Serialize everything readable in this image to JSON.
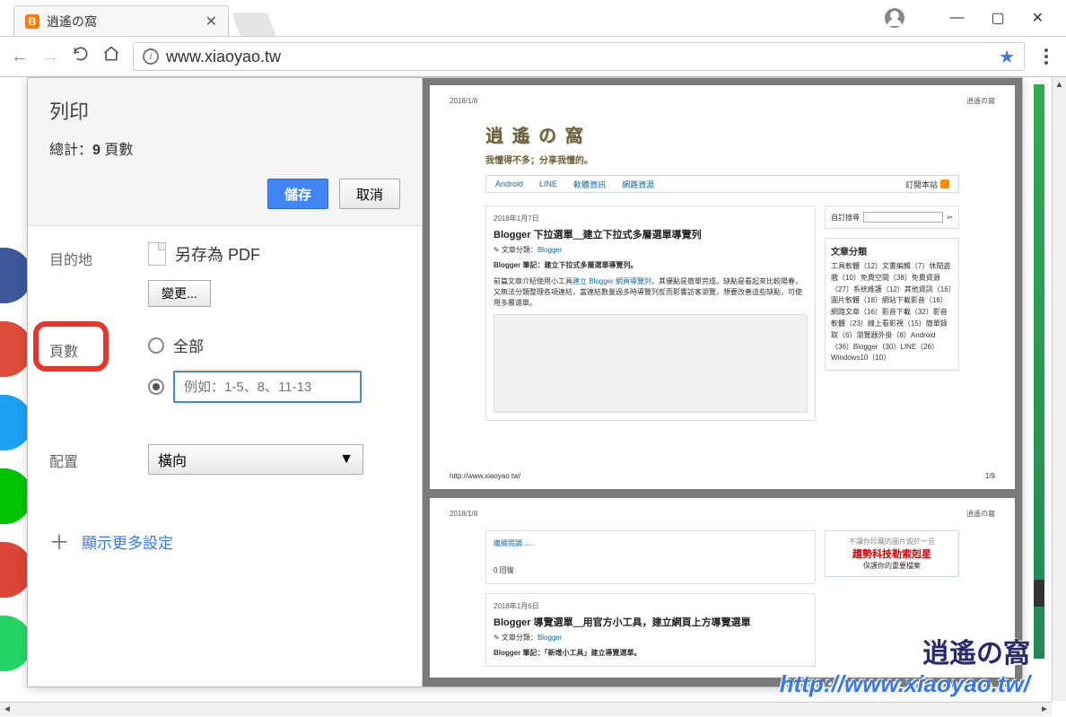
{
  "window": {
    "minimize": "—",
    "maximize": "▢",
    "close": "✕"
  },
  "tab": {
    "favicon_letter": "B",
    "title": "逍遙の窩",
    "close": "✕"
  },
  "addressbar": {
    "url": "www.xiaoyao.tw"
  },
  "print": {
    "title": "列印",
    "total_prefix": "總計：",
    "total_count": "9",
    "total_suffix": " 頁數",
    "save": "儲存",
    "cancel": "取消",
    "dest_label": "目的地",
    "dest_value": "另存為 PDF",
    "change": "變更...",
    "pages_label": "頁數",
    "pages_all": "全部",
    "pages_placeholder": "例如：1-5、8、11-13",
    "layout_label": "配置",
    "layout_value": "橫向",
    "more": "顯示更多設定"
  },
  "preview": {
    "date_header": "2018/1/8",
    "source": "逍遙の窩",
    "logo": "逍 遙 の 窩",
    "tagline": "我懂得不多；分享我懂的。",
    "nav": {
      "a": "Android",
      "b": "LINE",
      "c": "軟體資訊",
      "d": "網路資源",
      "rss": "訂閱本站"
    },
    "post1": {
      "date": "2018年1月7日",
      "title": "Blogger 下拉選單＿建立下拉式多層選單導覽列",
      "cat_prefix": "✎ 文章分類：",
      "cat_link": "Blogger",
      "note": "Blogger 筆記：建立下拉式多層選單導覽列。",
      "body_a": "前篇文章介紹使用小工具",
      "body_link": "建立 Blogger 網頁導覽列",
      "body_b": "，其優點是簡單完成，缺點是看起來比較陽春，又無法分類整理各項連結，當連結數量過多時導覽列反而影響訪客瀏覽，想要改善這些缺點，可使用多層選單。"
    },
    "sidebar": {
      "search": "自訂搜尋",
      "cat_title": "文章分類",
      "tags": "工具軟體（12）文書編輯（7）休閒遊戲（10）免費空間（38）免費資源（27）系統維護（12）其他資訊（16）圖片軟體（18）網站下載影音（16）網路文章（16）影音下載（32）影音軟體（23）線上看影視（15）簡單錄取（6）瀏覽器外掛（8）Android（36）Blogger（30）LINE（26）Windows10（10）"
    },
    "footer_url": "http://www.xiaoyao.tw/",
    "footer_page": "1/9",
    "page2": {
      "continue": "繼續閱讀......",
      "reply": "0 回復",
      "post_date": "2018年1月6日",
      "post_title": "Blogger 導覽選單＿用官方小工具，建立網頁上方導覽選單",
      "cat_prefix": "✎ 文章分類：",
      "cat_link": "Blogger",
      "note": "Blogger 筆記：「新增小工具」建立導覽選單。"
    },
    "ad": {
      "line1": "不讓你珍藏的圖片毀於一旦",
      "line2": "趨勢科技勒索剋星",
      "line3": "保護你的重要檔案"
    }
  },
  "watermark": {
    "logo": "逍遙の窩",
    "url": "http://www.xiaoyao.tw/"
  },
  "social_colors": {
    "a": "#3b5998",
    "b": "#dd4b39",
    "c": "#1da1f2",
    "d": "#00c300",
    "e": "#db4437",
    "f": "#25d366"
  }
}
